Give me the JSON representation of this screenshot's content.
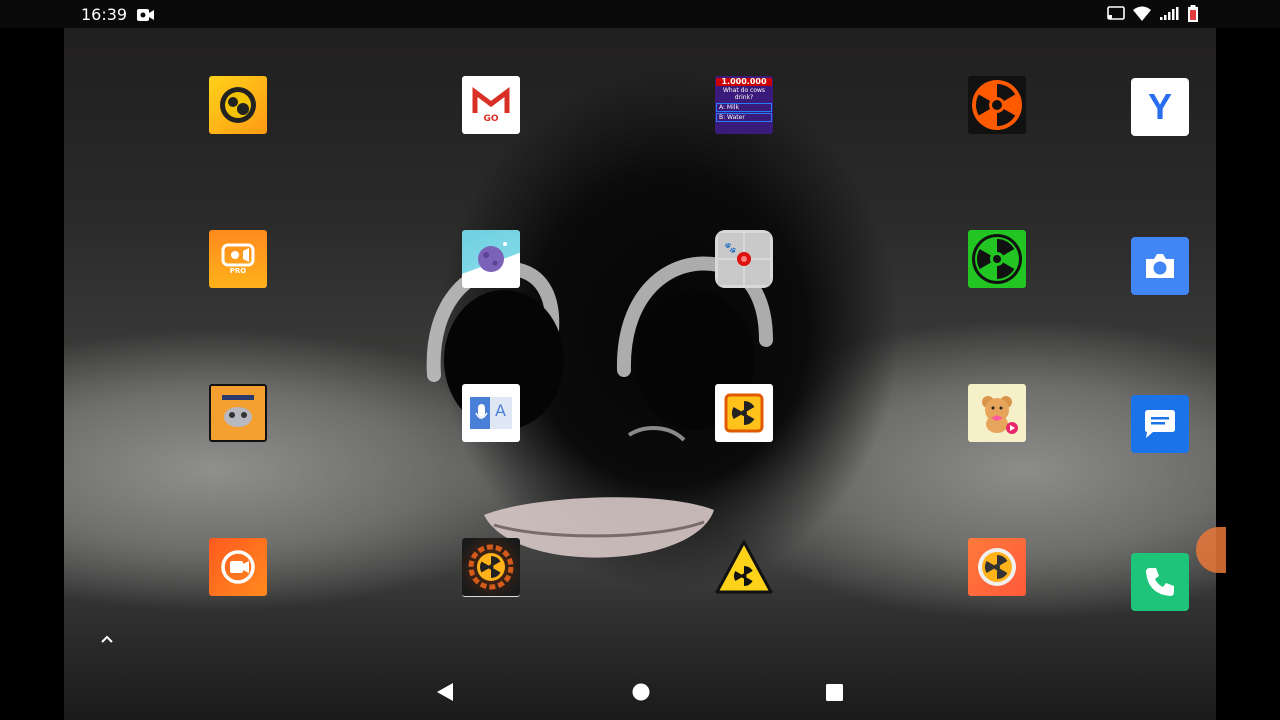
{
  "status_bar": {
    "time": "16:39",
    "left_icons": [
      "screen-record-icon"
    ],
    "right_icons": [
      "cast-icon",
      "wifi-icon",
      "cellular-signal-icon",
      "battery-icon"
    ]
  },
  "home_grid": {
    "rows": [
      [
        {
          "icon": "brawl-stars-icon"
        },
        {
          "icon": "gmail-go-icon",
          "text": "GO"
        },
        {
          "icon": "quiz-app-icon",
          "text": [
            "1.000.000",
            "What do cows drink?",
            "A: Milk",
            "B: Water"
          ]
        },
        {
          "icon": "red-radiation-icon"
        }
      ],
      [
        {
          "icon": "video-recorder-pro-icon",
          "text": "PRO"
        },
        {
          "icon": "planet-app-icon"
        },
        {
          "icon": "cat-target-app-icon"
        },
        {
          "icon": "green-radiation-icon"
        }
      ],
      [
        {
          "icon": "human-to-human-icon"
        },
        {
          "icon": "voice-translate-icon",
          "text": "A"
        },
        {
          "icon": "radiation-sign-icon"
        },
        {
          "icon": "teddy-bear-video-icon"
        }
      ],
      [
        {
          "icon": "screen-recorder-icon"
        },
        {
          "icon": "radiation-gear-icon"
        },
        {
          "icon": "radiation-triangle-icon"
        },
        {
          "icon": "radiation-circle-icon"
        }
      ]
    ]
  },
  "dock": [
    {
      "icon": "yandex-icon",
      "text": "Y"
    },
    {
      "icon": "camera-icon"
    },
    {
      "icon": "messages-icon"
    },
    {
      "icon": "phone-icon"
    }
  ],
  "app_drawer": {
    "icon": "chevron-up-icon"
  },
  "nav_bar": [
    "back-icon",
    "home-icon",
    "recents-icon"
  ],
  "colors": {
    "gmail_red": "#d93025",
    "dock_blue": "#4285f4",
    "phone_green": "#1fc47b",
    "radiation_orange": "#ff5a00",
    "radiation_green": "#22c522"
  }
}
